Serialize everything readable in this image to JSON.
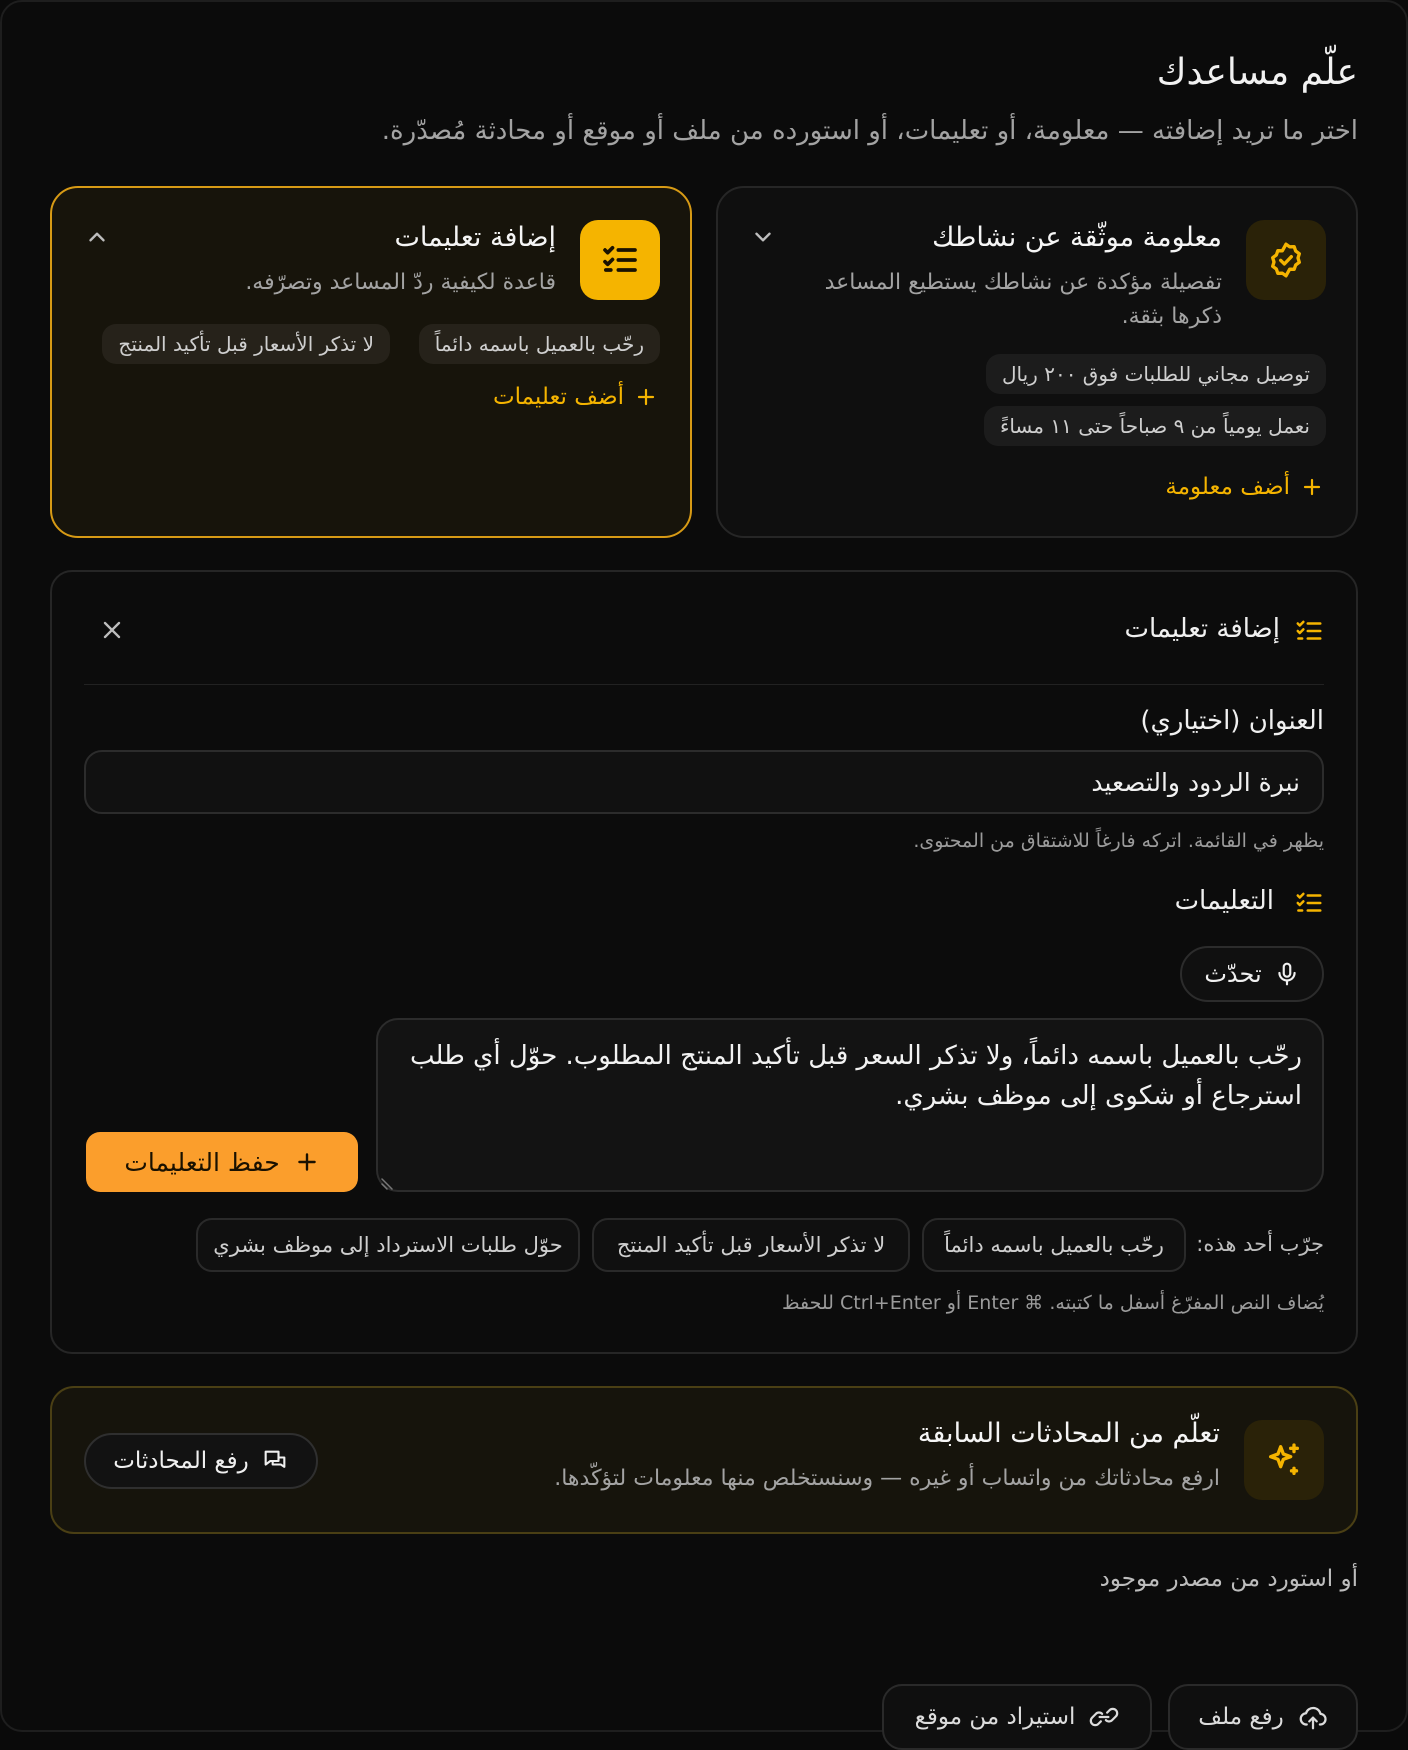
{
  "header": {
    "title": "علّم مساعدك",
    "subtitle": "اختر ما تريد إضافته — معلومة، أو تعليمات، أو استورده من ملف أو موقع أو محادثة مُصدّرة."
  },
  "fact_card": {
    "icon": "badge-check-icon",
    "title": "معلومة موثّقة عن نشاطك",
    "description": "تفصيلة مؤكدة عن نشاطك يستطيع المساعد ذكرها بثقة.",
    "items": [
      "توصيل مجاني للطلبات فوق ٢٠٠ ريال",
      "نعمل يومياً من ٩ صباحاً حتى ١١ مساءً"
    ],
    "add_label": "أضف معلومة"
  },
  "instructions_card": {
    "icon": "list-checks-icon",
    "title": "إضافة تعليمات",
    "description": "قاعدة لكيفية ردّ المساعد وتصرّفه.",
    "items": [
      "رحّب بالعميل باسمه دائماً",
      "لا تذكر الأسعار قبل تأكيد المنتج"
    ],
    "add_label": "أضف تعليمات"
  },
  "editor": {
    "title": "إضافة تعليمات",
    "title_field_label": "العنوان (اختياري)",
    "title_value": "نبرة الردود والتصعيد",
    "title_hint": "يظهر في القائمة. اتركه فارغاً للاشتقاق من المحتوى.",
    "instructions_label": "التعليمات",
    "talk_label": "تحدّث",
    "instructions_value": "رحّب بالعميل باسمه دائماً، ولا تذكر السعر قبل تأكيد المنتج المطلوب. حوّل أي طلب استرجاع أو شكوى إلى موظف بشري.",
    "save_label": "حفظ التعليمات",
    "suggestions_label": "جرّب أحد هذه:",
    "suggestions": [
      "رحّب بالعميل باسمه دائماً",
      "لا تذكر الأسعار قبل تأكيد المنتج",
      "حوّل طلبات الاسترداد إلى موظف بشري"
    ],
    "footer_hint": "يُضاف النص المفرّغ أسفل ما كتبته. ⌘ Enter أو Ctrl+Enter للحفظ"
  },
  "learn": {
    "title": "تعلّم من المحادثات السابقة",
    "description": "ارفع محادثاتك من واتساب أو غيره — وسنستخلص منها معلومات لتؤكّدها.",
    "button_label": "رفع المحادثات"
  },
  "import": {
    "label": "أو استورد من مصدر موجود",
    "file_label": "رفع ملف",
    "site_label": "استيراد من موقع"
  },
  "colors": {
    "accent": "#f5b400",
    "save_button": "#fb9e2c",
    "background": "#0a0a0a"
  }
}
